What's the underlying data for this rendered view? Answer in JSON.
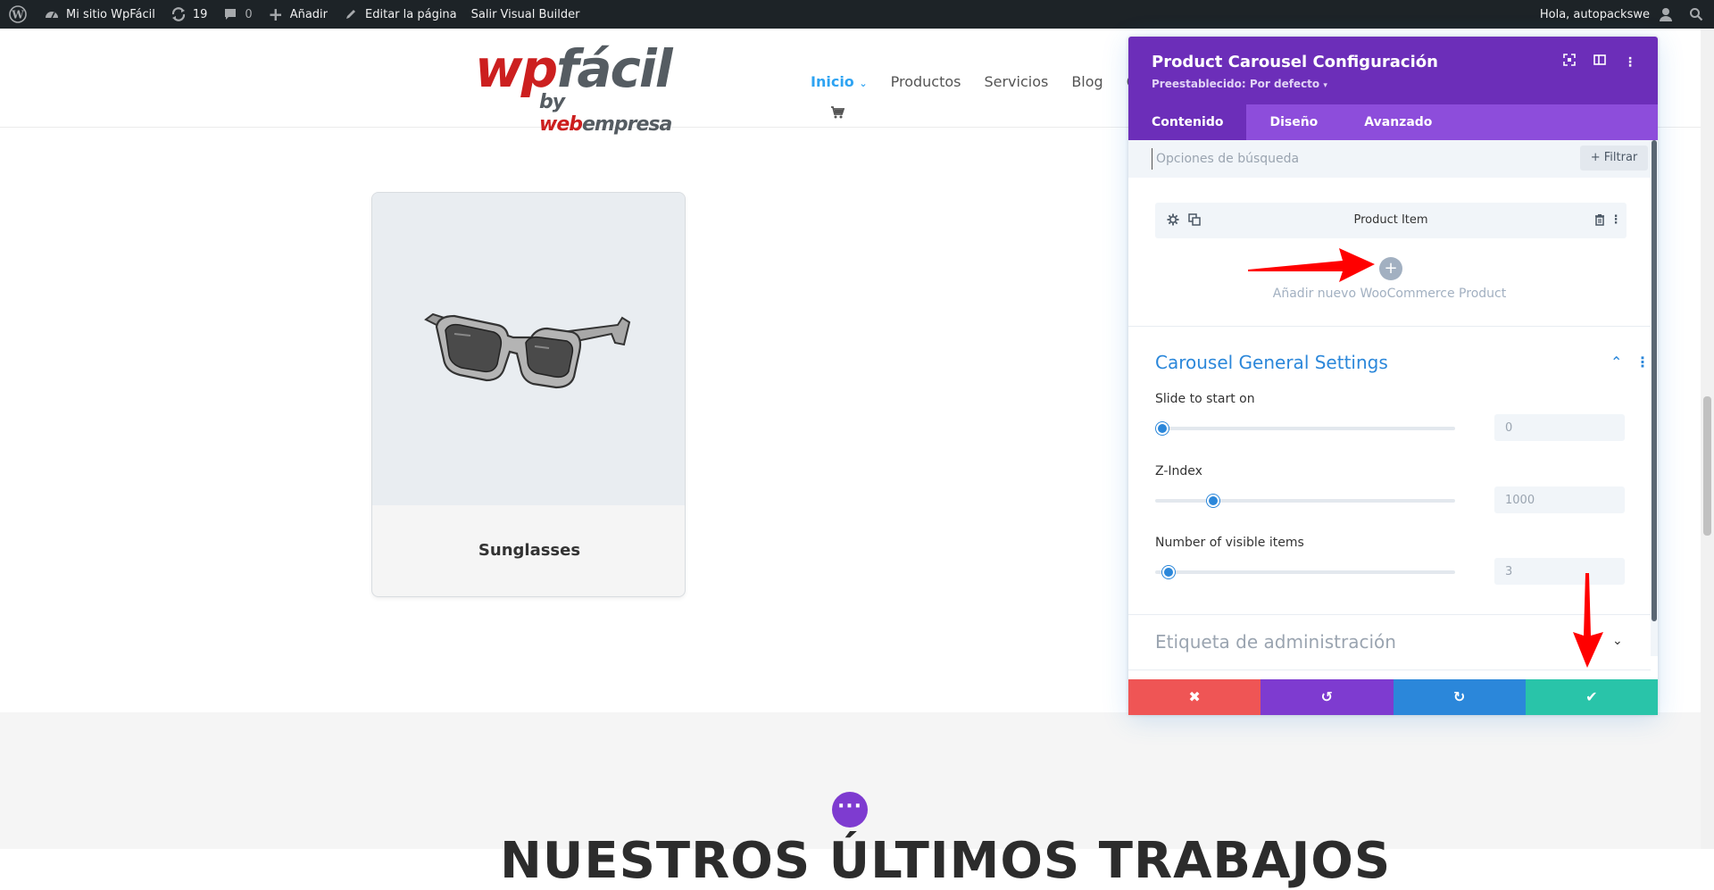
{
  "admin_bar": {
    "site_name": "Mi sitio WpFácil",
    "updates_count": "19",
    "comments_count": "0",
    "add_label": "Añadir",
    "edit_page_label": "Editar la página",
    "exit_builder_label": "Salir Visual Builder",
    "greeting": "Hola, autopackswe"
  },
  "header": {
    "logo": {
      "wp": "wp",
      "facil": "fácil",
      "by": "by ",
      "web": "web",
      "empresa": "empresa"
    },
    "nav": [
      "Inicio",
      "Productos",
      "Servicios",
      "Blog",
      "Qu"
    ]
  },
  "product_card": {
    "title": "Sunglasses"
  },
  "bottom": {
    "section_title": "NUESTROS ÚLTIMOS TRABAJOS"
  },
  "panel": {
    "title": "Product Carousel Configuración",
    "preset": "Preestablecido: Por defecto",
    "tabs": [
      "Contenido",
      "Diseño",
      "Avanzado"
    ],
    "search_placeholder": "Opciones de búsqueda",
    "filter_label": "Filtrar",
    "item_label": "Product Item",
    "add_item_label": "Añadir nuevo WooCommerce Product",
    "carousel_section": "Carousel General Settings",
    "fields": [
      {
        "label": "Slide to start on",
        "value": "0",
        "fraction": 0.0
      },
      {
        "label": "Z-Index",
        "value": "1000",
        "fraction": 0.16
      },
      {
        "label": "Number of visible items",
        "value": "3",
        "fraction": 0.02
      }
    ],
    "admin_label_section": "Etiqueta de administración"
  },
  "colors": {
    "admin_bar": "#1d2327",
    "panel_header": "#6c2eb9",
    "panel_tabs": "#8d4ddb",
    "accent_blue": "#2b87da",
    "cancel": "#ef5555",
    "undo": "#7e3bd0",
    "redo": "#2b87da",
    "save": "#29c4a9",
    "logo_red": "#cc1f1f"
  },
  "icons": [
    "wordpress-icon",
    "dashboard-icon",
    "updates-icon",
    "comments-icon",
    "plus-icon",
    "pencil-icon",
    "user-icon",
    "search-icon",
    "cart-icon",
    "chevron-down-icon",
    "expand-icon",
    "columns-icon",
    "more-icon",
    "gear-icon",
    "duplicate-icon",
    "trash-icon",
    "chevron-up-icon",
    "close-icon",
    "undo-icon",
    "redo-icon",
    "check-icon"
  ]
}
